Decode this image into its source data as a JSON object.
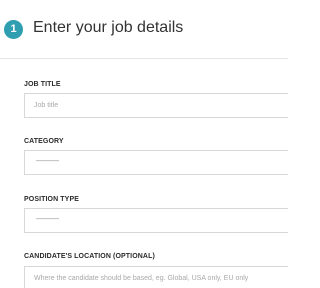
{
  "step": {
    "number": "1",
    "title": "Enter your job details"
  },
  "fields": {
    "job_title": {
      "label": "JOB TITLE",
      "placeholder": "Job title"
    },
    "category": {
      "label": "CATEGORY",
      "value": "———"
    },
    "position_type": {
      "label": "POSITION TYPE",
      "value": "———"
    },
    "location": {
      "label": "CANDIDATE'S LOCATION (OPTIONAL)",
      "placeholder": "Where the candidate should be based, eg. Global, USA only, EU only"
    }
  },
  "colors": {
    "accent": "#2e9eb0",
    "label": "#2b2b2b",
    "placeholder": "#a8a8a8",
    "border": "#d8d8d8"
  }
}
